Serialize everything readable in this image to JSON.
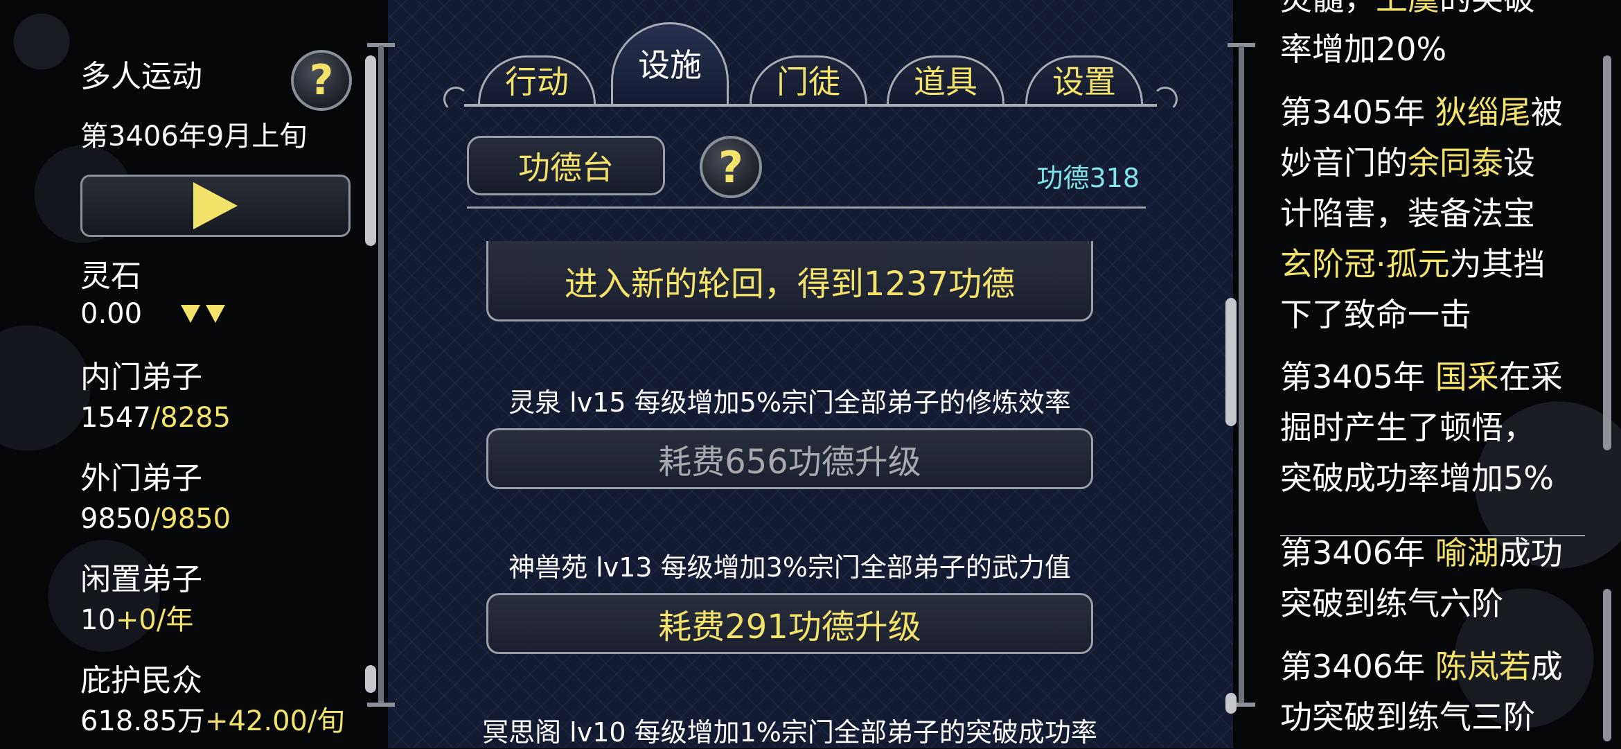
{
  "left": {
    "title": "多人运动",
    "date": "第3406年9月上旬",
    "spirit_stone_label": "灵石",
    "spirit_stone_value": "0.00",
    "inner_label": "内门弟子",
    "inner_current": "1547",
    "inner_max": "/8285",
    "outer_label": "外门弟子",
    "outer_current": "9850",
    "outer_max": "/9850",
    "idle_label": "闲置弟子",
    "idle_current": "10",
    "idle_rate": "+0/年",
    "protect_label": "庇护民众",
    "protect_value": "618.85万",
    "protect_rate": "+42.00/旬",
    "help_glyph": "?"
  },
  "tabs": [
    {
      "label": "行动",
      "active": false
    },
    {
      "label": "设施",
      "active": true
    },
    {
      "label": "门徒",
      "active": false
    },
    {
      "label": "道具",
      "active": false
    },
    {
      "label": "设置",
      "active": false
    }
  ],
  "center": {
    "merit_platform_label": "功德台",
    "help_glyph": "?",
    "merit_count": "功德318",
    "reincarnate_label": "进入新的轮回，得到1237功德",
    "facilities": [
      {
        "desc": "灵泉 lv15 每级增加5%宗门全部弟子的修炼效率",
        "button": "耗费656功德升级",
        "enabled": false
      },
      {
        "desc": "神兽苑 lv13 每级增加3%宗门全部弟子的武力值",
        "button": "耗费291功德升级",
        "enabled": true
      },
      {
        "desc": "冥思阁 lv10 每级增加1%宗门全部弟子的突破成功率"
      }
    ]
  },
  "log": {
    "e0": {
      "l1a": "灵髓，",
      "l1b": "上虞",
      "l1c": "的突破",
      "l2": "率增加20%"
    },
    "e1": {
      "l1a": "第3405年 ",
      "l1b": "狄缁尾",
      "l1c": "被",
      "l2a": "妙音门的",
      "l2b": "余同泰",
      "l2c": "设",
      "l3": "计陷害，装备法宝",
      "l4a": "玄阶冠·孤元",
      "l4b": "为其挡",
      "l5": "下了致命一击"
    },
    "e2": {
      "l1a": "第3405年 ",
      "l1b": "国采",
      "l1c": "在采",
      "l2": "掘时产生了顿悟，",
      "l3": "突破成功率增加5%"
    },
    "e3": {
      "l1a": "第3406年 ",
      "l1b": "喻湖",
      "l1c": "成功",
      "l2": "突破到练气六阶"
    },
    "e4": {
      "l1a": "第3406年 ",
      "l1b": "陈岚若",
      "l1c": "成",
      "l2": "功突破到练气三阶"
    }
  },
  "colors": {
    "accent": "#f4e36a",
    "info": "#7fe3e8",
    "panel": "#141b31"
  }
}
